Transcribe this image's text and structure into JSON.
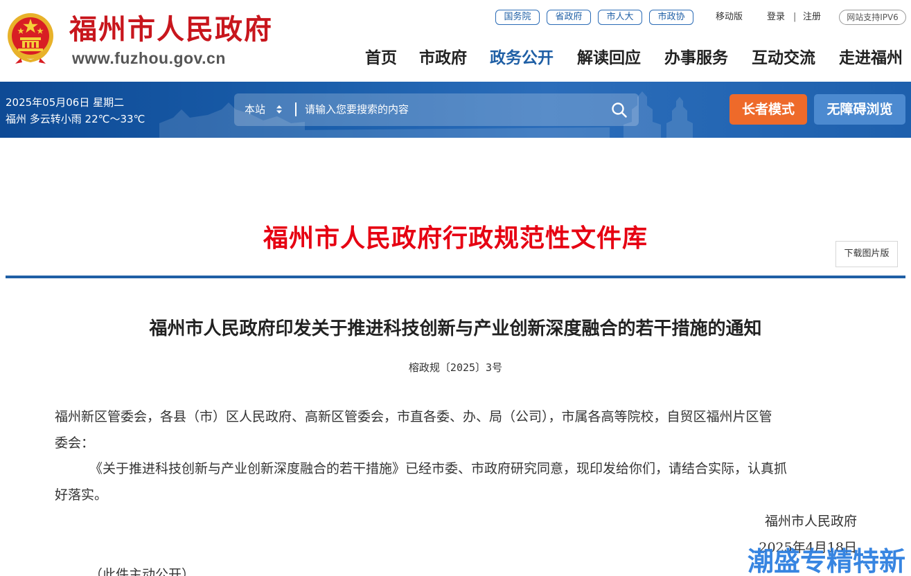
{
  "header": {
    "site_name": "福州市人民政府",
    "site_url": "www.fuzhou.gov.cn",
    "top_links": [
      "国务院",
      "省政府",
      "市人大",
      "市政协"
    ],
    "mobile": "移动版",
    "login": "登录",
    "separator": "|",
    "register": "注册",
    "ipv6": "网站支持IPV6",
    "nav": [
      "首页",
      "市政府",
      "政务公开",
      "解读回应",
      "办事服务",
      "互动交流",
      "走进福州"
    ],
    "active_nav": "政务公开"
  },
  "banner": {
    "date": "2025年05月06日 星期二",
    "weather": "福州 多云转小雨 22℃～33℃",
    "search": {
      "scope": "本站",
      "placeholder": "请输入您要搜索的内容"
    },
    "elder_mode": "长者模式",
    "accessibility": "无障碍浏览"
  },
  "library": {
    "title": "福州市人民政府行政规范性文件库",
    "download_button": "下载图片版"
  },
  "document": {
    "title": "福州市人民政府印发关于推进科技创新与产业创新深度融合的若干措施的通知",
    "number": "榕政规〔2025〕3号",
    "addressee_line1": "福州新区管委会，各县（市）区人民政府、高新区管委会，市直各委、办、局（公司），市属各高等院校，自贸区福州片区管",
    "addressee_line2": "委会：",
    "body_line1": "《关于推进科技创新与产业创新深度融合的若干措施》已经市委、市政府研究同意，现印发给你们，请结合实际，认真抓",
    "body_line2": "好落实。",
    "signature": "福州市人民政府",
    "date": "2025年4月18日",
    "disclosure": "（此件主动公开）"
  },
  "watermark": "潮盛专精特新",
  "colors": {
    "brand_red": "#c8161d",
    "title_red": "#e60012",
    "nav_active": "#1f5fa5",
    "banner_blue": "#1a5eab",
    "elder_button": "#ee6a2a",
    "accessibility_button": "#4c8ad0",
    "watermark_blue": "#2d7fe0"
  },
  "icons": {
    "emblem": "national-emblem-icon",
    "search": "search-icon",
    "scope_arrow": "sort-arrows-icon"
  }
}
